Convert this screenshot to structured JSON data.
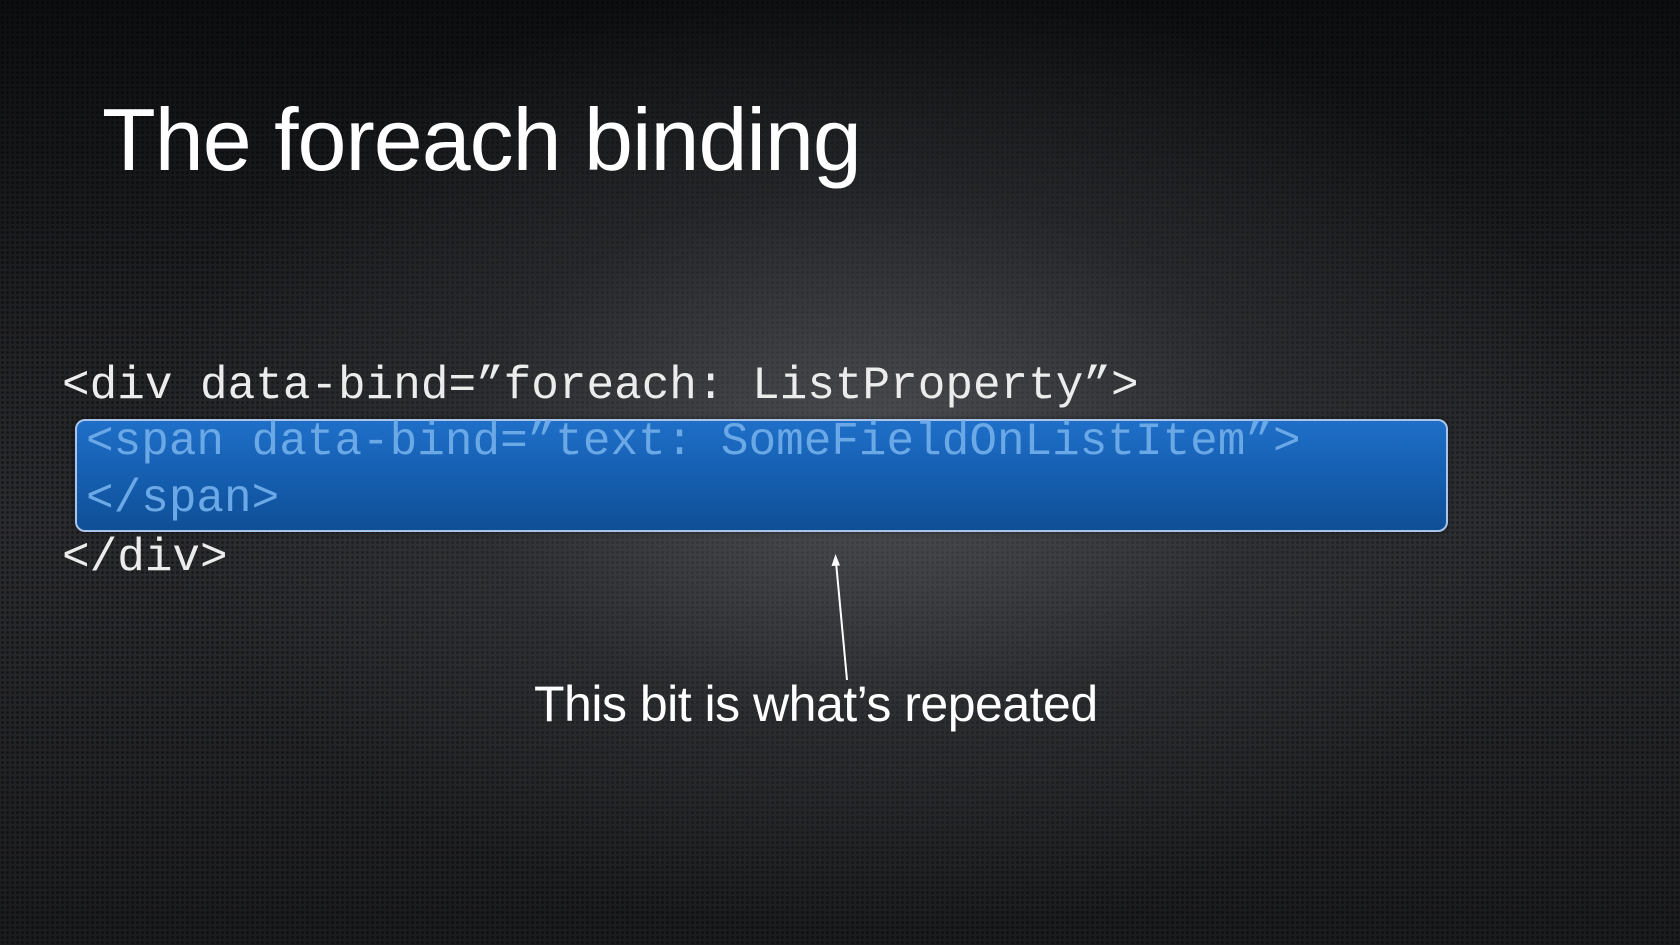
{
  "slide": {
    "title": "The foreach binding",
    "code": {
      "outer_open": "<div data-bind=”foreach: ListProperty”>",
      "inner_line_1": "<span data-bind=”text: SomeFieldOnListItem”>",
      "inner_line_2": "</span>",
      "outer_close": "</div>"
    },
    "caption": "This bit is what’s repeated"
  },
  "colors": {
    "highlight_fill": "#1660b3",
    "highlight_border": "#a9c4e8",
    "inner_code_text": "#6aa8e6",
    "outer_code_text": "#ececec",
    "title_text": "#ffffff"
  }
}
